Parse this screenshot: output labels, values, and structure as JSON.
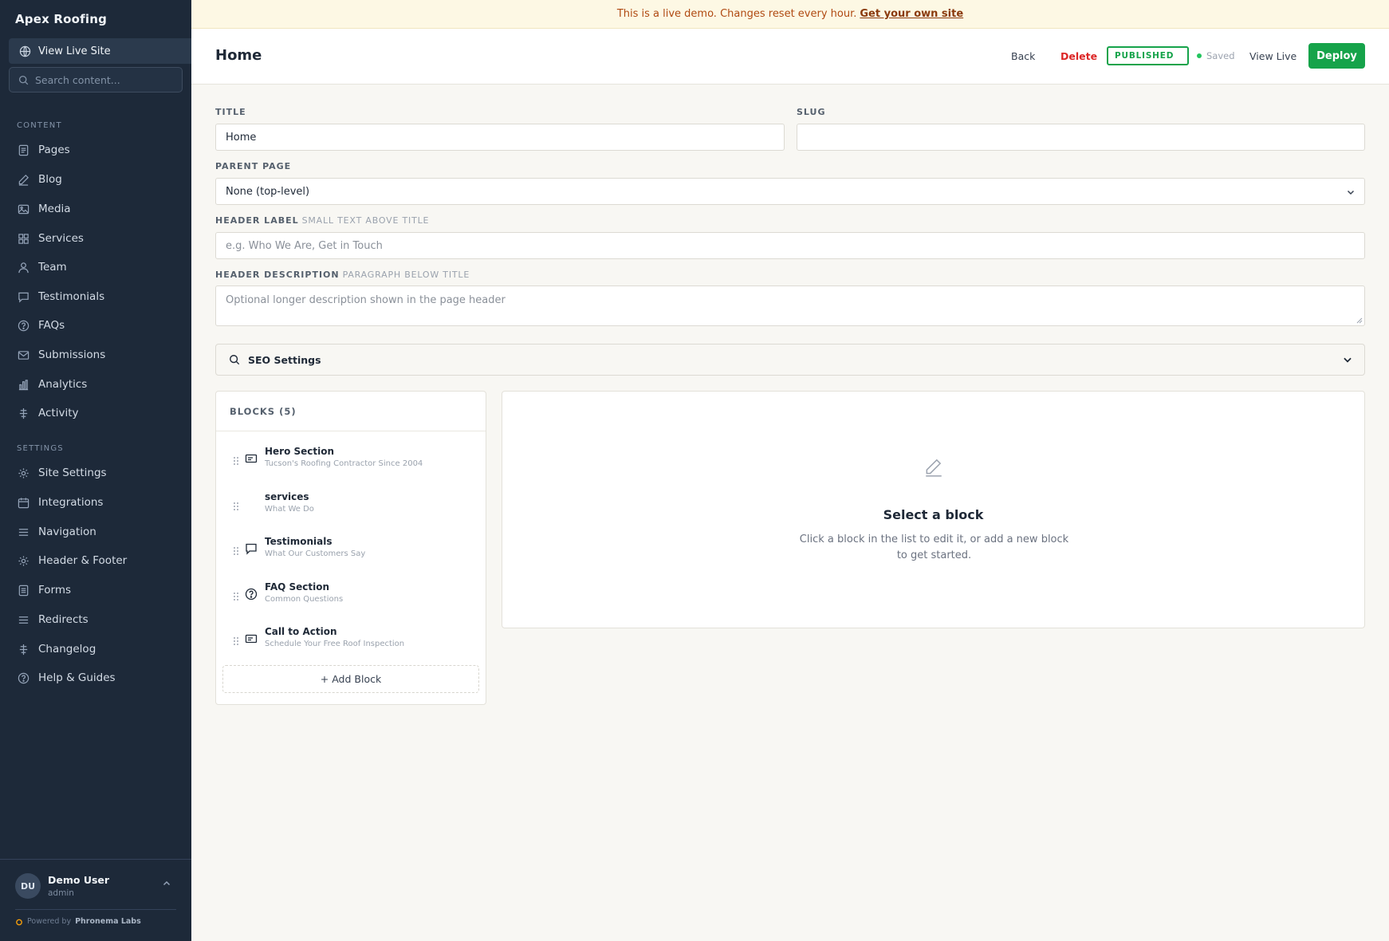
{
  "banner": {
    "text": "This is a live demo. Changes reset every hour.",
    "link": "Get your own site"
  },
  "sidebar": {
    "brand": "Apex Roofing",
    "view_live": "View Live Site",
    "search_placeholder": "Search content...",
    "content_label": "CONTENT",
    "content_items": [
      {
        "label": "Pages",
        "icon": "file-icon"
      },
      {
        "label": "Blog",
        "icon": "pen-icon"
      },
      {
        "label": "Media",
        "icon": "image-icon"
      },
      {
        "label": "Services",
        "icon": "grid-icon"
      },
      {
        "label": "Team",
        "icon": "user-icon"
      },
      {
        "label": "Testimonials",
        "icon": "message-icon"
      },
      {
        "label": "FAQs",
        "icon": "help-circle-icon"
      },
      {
        "label": "Submissions",
        "icon": "mail-icon"
      },
      {
        "label": "Analytics",
        "icon": "bar-chart-icon"
      },
      {
        "label": "Activity",
        "icon": "activity-icon"
      }
    ],
    "settings_label": "SETTINGS",
    "settings_items": [
      {
        "label": "Site Settings",
        "icon": "gear-icon"
      },
      {
        "label": "Integrations",
        "icon": "calendar-icon"
      },
      {
        "label": "Navigation",
        "icon": "menu-icon"
      },
      {
        "label": "Header & Footer",
        "icon": "gear-icon"
      },
      {
        "label": "Forms",
        "icon": "form-icon"
      },
      {
        "label": "Redirects",
        "icon": "menu-icon"
      },
      {
        "label": "Changelog",
        "icon": "activity-icon"
      },
      {
        "label": "Help & Guides",
        "icon": "help-circle-icon"
      }
    ],
    "user": {
      "initials": "DU",
      "name": "Demo User",
      "role": "admin"
    },
    "powered_prefix": "Powered by",
    "powered_brand": "Phronema Labs"
  },
  "topbar": {
    "title": "Home",
    "back": "Back",
    "delete": "Delete",
    "status": "PUBLISHED",
    "saved": "Saved",
    "view_live": "View Live",
    "deploy": "Deploy"
  },
  "form": {
    "title_label": "TITLE",
    "title_value": "Home",
    "slug_label": "SLUG",
    "slug_value": "",
    "parent_label": "PARENT PAGE",
    "parent_value": "None (top-level)",
    "header_label_label": "HEADER LABEL",
    "header_label_hint": "SMALL TEXT ABOVE TITLE",
    "header_label_placeholder": "e.g. Who We Are, Get in Touch",
    "header_desc_label": "HEADER DESCRIPTION",
    "header_desc_hint": "PARAGRAPH BELOW TITLE",
    "header_desc_placeholder": "Optional longer description shown in the page header",
    "seo_label": "SEO Settings"
  },
  "blocks": {
    "heading": "BLOCKS (5)",
    "items": [
      {
        "title": "Hero Section",
        "subtitle": "Tucson's Roofing Contractor Since 2004",
        "icon": "layout-card-icon"
      },
      {
        "title": "services",
        "subtitle": "What We Do",
        "icon": ""
      },
      {
        "title": "Testimonials",
        "subtitle": "What Our Customers Say",
        "icon": "message-icon"
      },
      {
        "title": "FAQ Section",
        "subtitle": "Common Questions",
        "icon": "help-circle-icon"
      },
      {
        "title": "Call to Action",
        "subtitle": "Schedule Your Free Roof Inspection",
        "icon": "layout-card-icon"
      }
    ],
    "add": "+ Add Block"
  },
  "editor": {
    "title": "Select a block",
    "description": "Click a block in the list to edit it, or add a new block to get started."
  }
}
